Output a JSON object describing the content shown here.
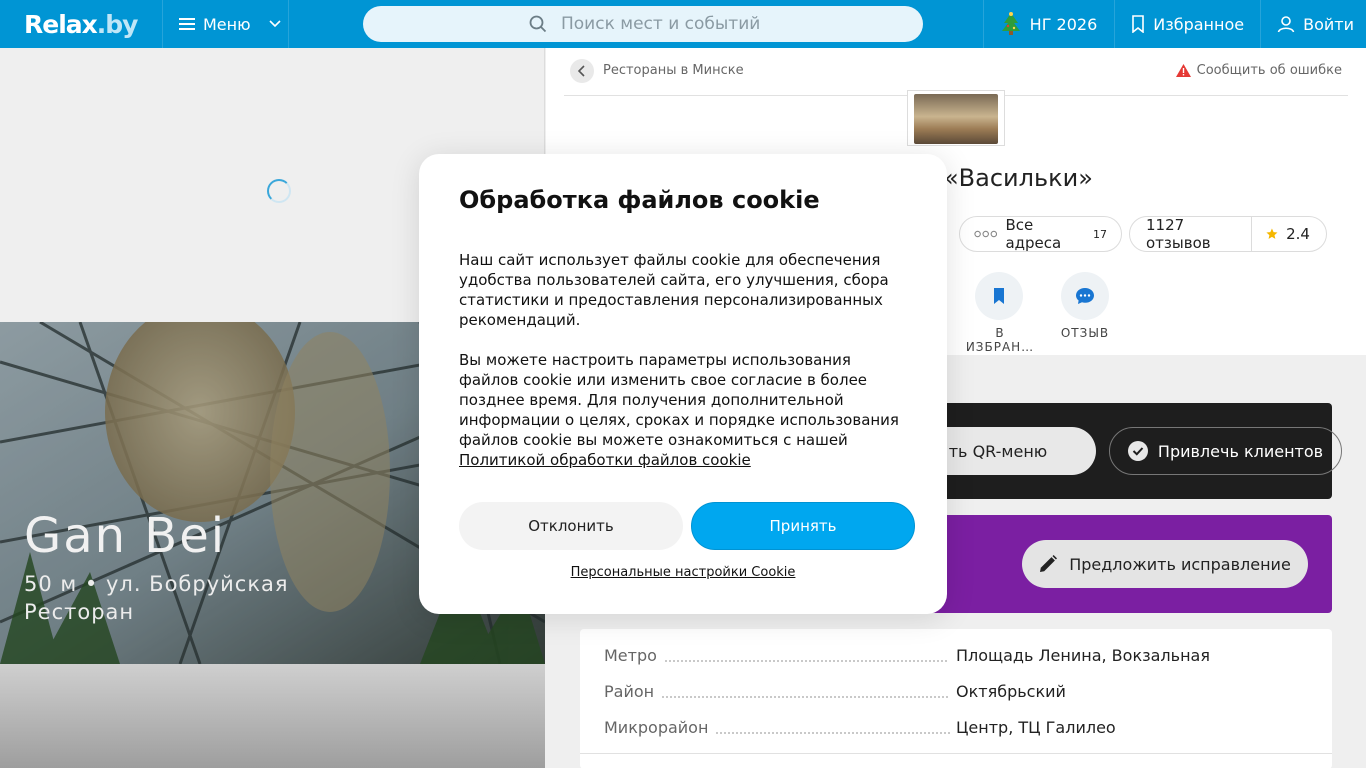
{
  "header": {
    "logo": "Relax",
    "logo_suffix": ".by",
    "menu_label": "Меню",
    "search_placeholder": "Поиск мест и событий",
    "ny_label": "НГ 2026",
    "favorites_label": "Избранное",
    "login_label": "Войти"
  },
  "left": {
    "hero_title": "Gan Bei",
    "hero_subtitle": "50 м • ул. Бобруйская",
    "hero_type": "Ресторан"
  },
  "right": {
    "breadcrumb": "Рестораны в Минске",
    "report_label": "Сообщить об ошибке",
    "place_title": "«Васильки»",
    "all_addresses_label": "Все адреса",
    "all_addresses_count": "17",
    "reviews_label": "1127 отзывов",
    "rating": "2.4",
    "actions": {
      "favorite_label": "В ИЗБРАН…",
      "review_label": "ОТЗЫВ"
    },
    "qr_menu_label": "ть QR-меню",
    "attract_label": "Привлечь клиентов",
    "suggest_label": "Предложить исправление",
    "info_rows": [
      {
        "key": "Метро",
        "value": "Площадь Ленина, Вокзальная"
      },
      {
        "key": "Район",
        "value": "Октябрьский"
      },
      {
        "key": "Микрорайон",
        "value": "Центр, ТЦ Галилео"
      }
    ]
  },
  "cookie_modal": {
    "title": "Обработка файлов cookie",
    "paragraph1": "Наш сайт использует файлы cookie для обеспечения удобства пользователей сайта, его улучшения, сбора статистики и предоставления персонализированных рекомендаций.",
    "paragraph2": "Вы можете настроить параметры использования файлов cookie или изменить свое согласие в более позднее время. Для получения дополнительной информации о целях, сроках и порядке использования файлов cookie вы можете ознакомиться с нашей",
    "policy_link": "Политикой обработки файлов cookie",
    "decline_label": "Отклонить",
    "accept_label": "Принять",
    "settings_link": "Персональные настройки Cookie"
  },
  "colors": {
    "header_bg": "#0095d4",
    "accept_bg": "#00a7ef",
    "purple_banner": "#7b1fa2",
    "dark_banner": "#1e1e1e",
    "warning": "#e53935",
    "star": "#f5b700",
    "action_icon": "#1976d2"
  },
  "icons": {
    "menu": "hamburger-icon",
    "search": "search-icon",
    "ny": "christmas-tree-icon",
    "favorites": "bookmark-icon",
    "login": "user-icon",
    "back": "chevron-left-icon",
    "report": "warning-icon",
    "addresses": "dots-icon",
    "rating": "star-icon",
    "review": "chat-icon",
    "attract": "check-circle-icon",
    "suggest": "pencil-icon"
  }
}
